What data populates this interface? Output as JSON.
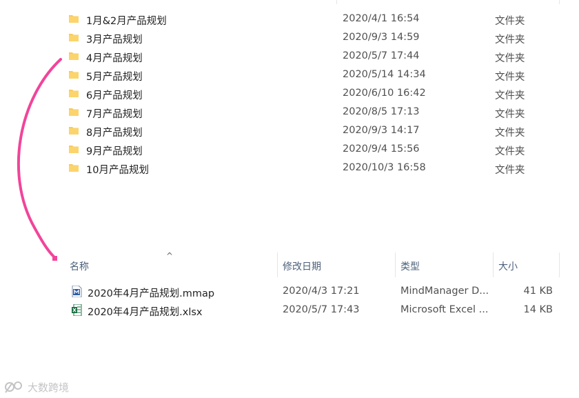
{
  "folders": [
    {
      "name": "1月&2月产品规划",
      "date": "2020/4/1 16:54",
      "type": "文件夹"
    },
    {
      "name": "3月产品规划",
      "date": "2020/9/3 14:59",
      "type": "文件夹"
    },
    {
      "name": "4月产品规划",
      "date": "2020/5/7 17:44",
      "type": "文件夹"
    },
    {
      "name": "5月产品规划",
      "date": "2020/5/14 14:34",
      "type": "文件夹"
    },
    {
      "name": "6月产品规划",
      "date": "2020/6/10 16:42",
      "type": "文件夹"
    },
    {
      "name": "7月产品规划",
      "date": "2020/8/5 17:13",
      "type": "文件夹"
    },
    {
      "name": "8月产品规划",
      "date": "2020/9/3 14:17",
      "type": "文件夹"
    },
    {
      "name": "9月产品规划",
      "date": "2020/9/4 15:56",
      "type": "文件夹"
    },
    {
      "name": "10月产品规划",
      "date": "2020/10/3 16:58",
      "type": "文件夹"
    }
  ],
  "columns": {
    "name": "名称",
    "modified": "修改日期",
    "type": "类型",
    "size": "大小",
    "sort_indicator": "^"
  },
  "files": [
    {
      "name": "2020年4月产品规划.mmap",
      "date": "2020/4/3 17:21",
      "type": "MindManager D...",
      "size": "41 KB",
      "icon": "mindmanager-file-icon"
    },
    {
      "name": "2020年4月产品规划.xlsx",
      "date": "2020/5/7 17:43",
      "type": "Microsoft Excel ...",
      "size": "14 KB",
      "icon": "excel-file-icon"
    }
  ],
  "colors": {
    "folder": "#f7c95e",
    "arrow": "#f2449a",
    "header_text": "#4c607a",
    "excel": "#1d7044",
    "mindmanager": "#2b5cab"
  },
  "watermark": {
    "text": "大数跨境"
  }
}
